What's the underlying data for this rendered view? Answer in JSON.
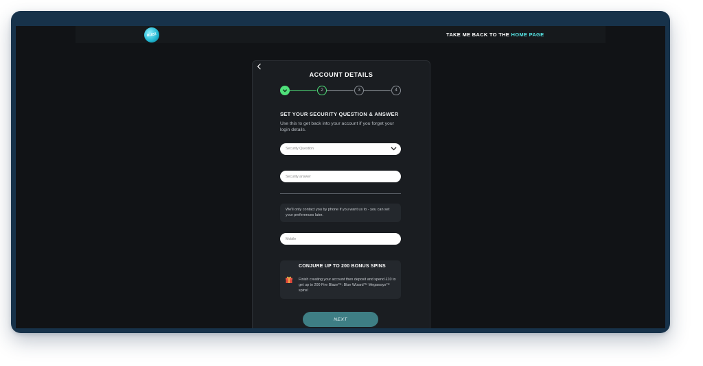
{
  "header": {
    "logo_text": "BUZZ",
    "back_link_prefix": "TAKE ME BACK TO THE ",
    "back_link_highlight": "HOME PAGE"
  },
  "form": {
    "title": "ACCOUNT DETAILS",
    "steps": [
      "",
      "2",
      "3",
      "4"
    ],
    "current_step": 2,
    "section_heading": "SET YOUR SECURITY QUESTION & ANSWER",
    "section_description": "Use this to get back into your account if you forget your login details.",
    "security_question_placeholder": "Security Question",
    "security_answer_placeholder": "Security answer",
    "contact_note": "We'll only contact you by phone if you want us to - you can set your preferences later.",
    "mobile_placeholder": "Mobile",
    "promo_title": "CONJURE UP TO 200 BONUS SPINS",
    "promo_text": "Finish creating your account then deposit and spend £10 to get up to 200 Fire Blaze™: Blue Wizard™ Megaways™ spins!",
    "next_label": "NEXT"
  },
  "colors": {
    "accent_green": "#4fe07a",
    "accent_cyan": "#57e6e6",
    "button_teal": "#3e7e84",
    "background": "#111316"
  },
  "icons": [
    "back-chevron-icon",
    "check-icon",
    "chevron-down-icon",
    "gift-icon"
  ]
}
